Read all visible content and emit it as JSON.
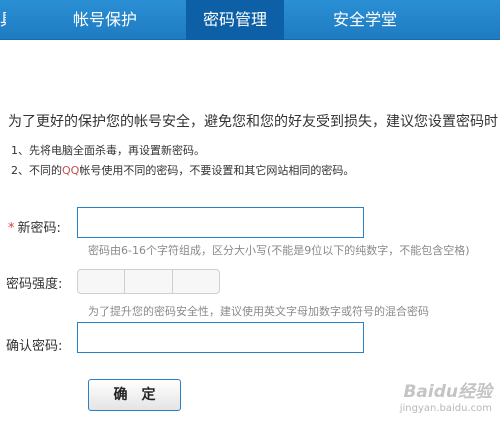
{
  "nav": {
    "tabs": [
      {
        "label": "具"
      },
      {
        "label": "帐号保护"
      },
      {
        "label": "密码管理",
        "active": true
      },
      {
        "label": "安全学堂"
      }
    ]
  },
  "intro": "为了更好的保护您的帐号安全，避免您和您的好友受到损失，建议您设置密码时：",
  "tips": {
    "tip1": "1、先将电脑全面杀毒，再设置新密码。",
    "tip2_prefix": "2、不同的",
    "tip2_qq": "QQ",
    "tip2_suffix": "帐号使用不同的密码，不要设置和其它网站相同的密码。"
  },
  "form": {
    "new_password": {
      "required_mark": "*",
      "label": "新密码:",
      "value": "",
      "hint": "密码由6-16个字符组成，区分大小写(不能是9位以下的纯数字，不能包含空格)"
    },
    "strength": {
      "label": "密码强度:",
      "level": 0,
      "hint": "为了提升您的密码安全性，建议使用英文字母加数字或符号的混合密码"
    },
    "confirm_password": {
      "label": "确认密码:",
      "value": ""
    },
    "submit_label": "确定"
  },
  "watermark": {
    "logo": "Baidu经验",
    "url": "jingyan.baidu.com"
  },
  "colors": {
    "nav_bg": "#1f7bc2",
    "nav_active": "#0d5fa6",
    "input_border": "#2b7fc4",
    "required": "#e03a3a",
    "qq_highlight": "#c0504d"
  }
}
